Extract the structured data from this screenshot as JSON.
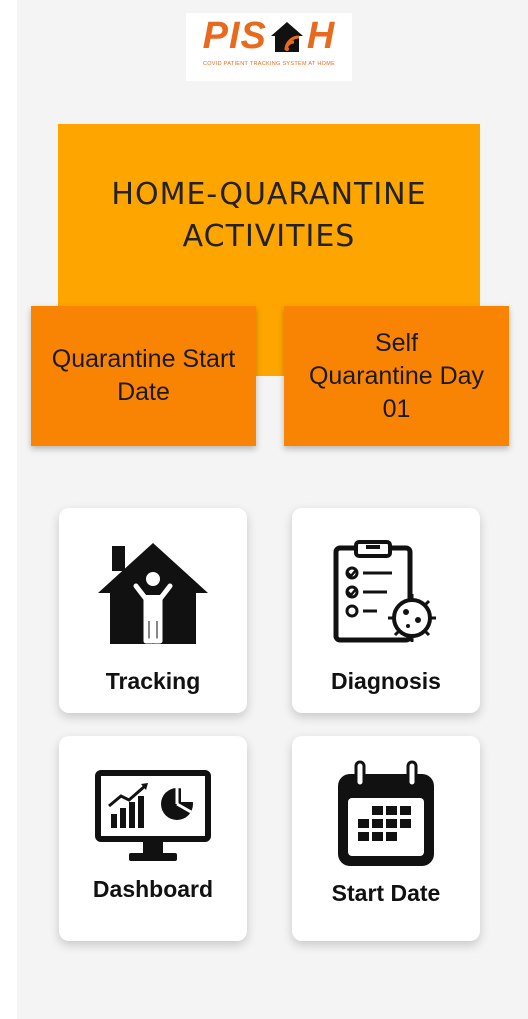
{
  "logo": {
    "left_text": "PIS",
    "right_text": "H",
    "tagline": "COVID PATIENT TRACKING SYSTEM AT HOME"
  },
  "hero": {
    "title_line1": "HOME-QUARANTINE",
    "title_line2": "ACTIVITIES"
  },
  "quarantine_start": {
    "line1": "Quarantine Start",
    "line2": "Date"
  },
  "quarantine_day": {
    "line1": "Self",
    "line2": "Quarantine Day",
    "line3": "01"
  },
  "cards": {
    "tracking": {
      "label": "Tracking",
      "icon": "house-person-icon"
    },
    "diagnosis": {
      "label": "Diagnosis",
      "icon": "clipboard-virus-icon"
    },
    "dashboard": {
      "label": "Dashboard",
      "icon": "monitor-chart-icon"
    },
    "start_date": {
      "label": "Start Date",
      "icon": "calendar-icon"
    }
  },
  "colors": {
    "hero": "#ffa500",
    "boxes": "#f98403",
    "logo": "#e86a1f"
  }
}
